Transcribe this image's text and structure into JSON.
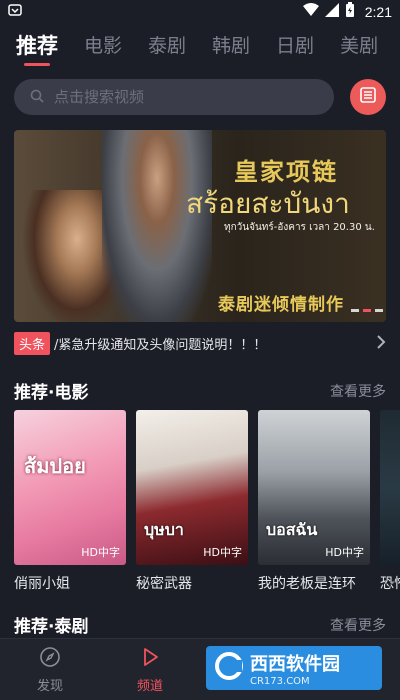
{
  "status_bar": {
    "time": "2:21"
  },
  "tabs": [
    {
      "label": "推荐"
    },
    {
      "label": "电影"
    },
    {
      "label": "泰剧"
    },
    {
      "label": "韩剧"
    },
    {
      "label": "日剧"
    },
    {
      "label": "美剧"
    }
  ],
  "search": {
    "placeholder": "点击搜索视频"
  },
  "banner": {
    "title_cn": "皇家项链",
    "title_th": "สร้อยสะบันงา",
    "schedule": "ทุกวันจันทร์-อังคาร เวลา 20.30 น.",
    "tagline": "泰剧迷倾情制作"
  },
  "news": {
    "badge": "头条",
    "text": "/紧急升级通知及头像问题说明！！！"
  },
  "section_movies": {
    "title": "推荐·电影",
    "more": "查看更多",
    "items": [
      {
        "title": "俏丽小姐",
        "quality": "HD中字",
        "poster_text": "ส้มปอย"
      },
      {
        "title": "秘密武器",
        "quality": "HD中字",
        "poster_text": "บุษบา"
      },
      {
        "title": "我的老板是连环",
        "quality": "HD中字",
        "poster_text": "บอสฉัน"
      },
      {
        "title": "恐怖",
        "quality": "",
        "poster_text": ""
      }
    ]
  },
  "section_thai": {
    "title": "推荐·泰剧",
    "more": "查看更多"
  },
  "bottom_nav": [
    {
      "label": "发现",
      "icon": "compass-icon"
    },
    {
      "label": "频道",
      "icon": "play-icon"
    },
    {
      "label": "",
      "icon": "check-box-icon"
    },
    {
      "label": "",
      "icon": "user-icon"
    }
  ],
  "watermark": {
    "text": "西西软件园",
    "sub": "CR173.COM"
  },
  "colors": {
    "accent": "#f0525e",
    "background": "#1c1e27"
  }
}
